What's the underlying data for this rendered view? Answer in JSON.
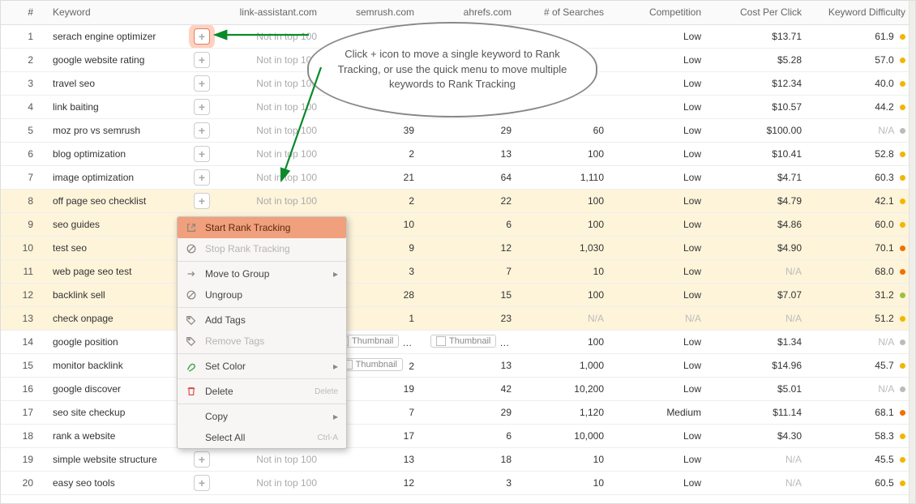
{
  "columns": {
    "num": "#",
    "keyword": "Keyword",
    "link": "link-assistant.com",
    "sem": "semrush.com",
    "ahr": "ahrefs.com",
    "searches": "# of Searches",
    "comp": "Competition",
    "cpc": "Cost Per Click",
    "diff": "Keyword Difficulty"
  },
  "callout": "Click + icon to move a single keyword to Rank Tracking, or use the quick menu to move multiple keywords to Rank Tracking",
  "menu": {
    "start": "Start Rank Tracking",
    "stop": "Stop Rank Tracking",
    "move": "Move to Group",
    "ungroup": "Ungroup",
    "addtags": "Add Tags",
    "rmtags": "Remove Tags",
    "color": "Set Color",
    "delete": "Delete",
    "delete_sc": "Delete",
    "copy": "Copy",
    "selectall": "Select All",
    "selectall_sc": "Ctrl-A"
  },
  "labels": {
    "notop": "Not in top 100",
    "na": "N/A",
    "thumbnail": "Thumbnail"
  },
  "rows": [
    {
      "n": "1",
      "kw": "serach engine optimizer",
      "link": "notop",
      "sem": "",
      "ahr": "",
      "srch": "",
      "comp": "Low",
      "cpc": "$13.71",
      "diff": "61.9",
      "dot": "y",
      "sel": false,
      "plus_hl": true
    },
    {
      "n": "2",
      "kw": "google website rating",
      "link": "notop",
      "sem": "",
      "ahr": "",
      "srch": "",
      "comp": "Low",
      "cpc": "$5.28",
      "diff": "57.0",
      "dot": "y",
      "sel": false
    },
    {
      "n": "3",
      "kw": "travel seo",
      "link": "notop",
      "sem": "",
      "ahr": "",
      "srch": "",
      "comp": "Low",
      "cpc": "$12.34",
      "diff": "40.0",
      "dot": "y",
      "sel": false
    },
    {
      "n": "4",
      "kw": "link baiting",
      "link": "notop",
      "sem": "",
      "ahr": "",
      "srch": "",
      "comp": "Low",
      "cpc": "$10.57",
      "diff": "44.2",
      "dot": "y",
      "sel": false
    },
    {
      "n": "5",
      "kw": "moz pro vs semrush",
      "link": "notop",
      "sem": "39",
      "ahr": "29",
      "srch": "60",
      "comp": "Low",
      "cpc": "$100.00",
      "diff": "N/A",
      "dot": "gr",
      "sel": false
    },
    {
      "n": "6",
      "kw": "blog optimization",
      "link": "notop",
      "sem": "2",
      "ahr": "13",
      "srch": "100",
      "comp": "Low",
      "cpc": "$10.41",
      "diff": "52.8",
      "dot": "y",
      "sel": false
    },
    {
      "n": "7",
      "kw": "image optimization",
      "link": "notop",
      "sem": "21",
      "ahr": "64",
      "srch": "1,110",
      "comp": "Low",
      "cpc": "$4.71",
      "diff": "60.3",
      "dot": "y",
      "sel": false
    },
    {
      "n": "8",
      "kw": "off page seo checklist",
      "link": "notop",
      "sem": "2",
      "ahr": "22",
      "srch": "100",
      "comp": "Low",
      "cpc": "$4.79",
      "diff": "42.1",
      "dot": "y",
      "sel": true
    },
    {
      "n": "9",
      "kw": "seo guides",
      "link": "",
      "sem": "10",
      "ahr": "6",
      "srch": "100",
      "comp": "Low",
      "cpc": "$4.86",
      "diff": "60.0",
      "dot": "y",
      "sel": true
    },
    {
      "n": "10",
      "kw": "test seo",
      "link": "",
      "sem": "9",
      "ahr": "12",
      "srch": "1,030",
      "comp": "Low",
      "cpc": "$4.90",
      "diff": "70.1",
      "dot": "o",
      "sel": true
    },
    {
      "n": "11",
      "kw": "web page seo test",
      "link": "",
      "sem": "3",
      "ahr": "7",
      "srch": "10",
      "comp": "Low",
      "cpc": "N/A",
      "diff": "68.0",
      "dot": "o",
      "sel": true
    },
    {
      "n": "12",
      "kw": "backlink sell",
      "link": "",
      "sem": "28",
      "ahr": "15",
      "srch": "100",
      "comp": "Low",
      "cpc": "$7.07",
      "diff": "31.2",
      "dot": "g",
      "sel": true
    },
    {
      "n": "13",
      "kw": "check onpage",
      "link": "",
      "sem": "1",
      "ahr": "23",
      "srch": "N/A",
      "comp": "N/A",
      "cpc": "N/A",
      "diff": "51.2",
      "dot": "y",
      "sel": true
    },
    {
      "n": "14",
      "kw": "google position",
      "link": "",
      "sem": "thumb17",
      "ahr": "thumb19",
      "srch": "100",
      "comp": "Low",
      "cpc": "$1.34",
      "diff": "N/A",
      "dot": "gr",
      "sel": false
    },
    {
      "n": "15",
      "kw": "monitor backlink",
      "link": "",
      "sem": "thumb2",
      "ahr": "13",
      "srch": "1,000",
      "comp": "Low",
      "cpc": "$14.96",
      "diff": "45.7",
      "dot": "y",
      "sel": false
    },
    {
      "n": "16",
      "kw": "google discover",
      "link": "",
      "sem": "19",
      "ahr": "42",
      "srch": "10,200",
      "comp": "Low",
      "cpc": "$5.01",
      "diff": "N/A",
      "dot": "gr",
      "sel": false
    },
    {
      "n": "17",
      "kw": "seo site checkup",
      "link": "",
      "sem": "7",
      "ahr": "29",
      "srch": "1,120",
      "comp": "Medium",
      "cpc": "$11.14",
      "diff": "68.1",
      "dot": "o",
      "sel": false
    },
    {
      "n": "18",
      "kw": "rank a website",
      "link": "",
      "sem": "17",
      "ahr": "6",
      "srch": "10,000",
      "comp": "Low",
      "cpc": "$4.30",
      "diff": "58.3",
      "dot": "y",
      "sel": false
    },
    {
      "n": "19",
      "kw": "simple website structure",
      "link": "notop",
      "sem": "13",
      "ahr": "18",
      "srch": "10",
      "comp": "Low",
      "cpc": "N/A",
      "diff": "45.5",
      "dot": "y",
      "sel": false
    },
    {
      "n": "20",
      "kw": "easy seo tools",
      "link": "notop",
      "sem": "12",
      "ahr": "3",
      "srch": "10",
      "comp": "Low",
      "cpc": "N/A",
      "diff": "60.5",
      "dot": "y",
      "sel": false
    }
  ]
}
